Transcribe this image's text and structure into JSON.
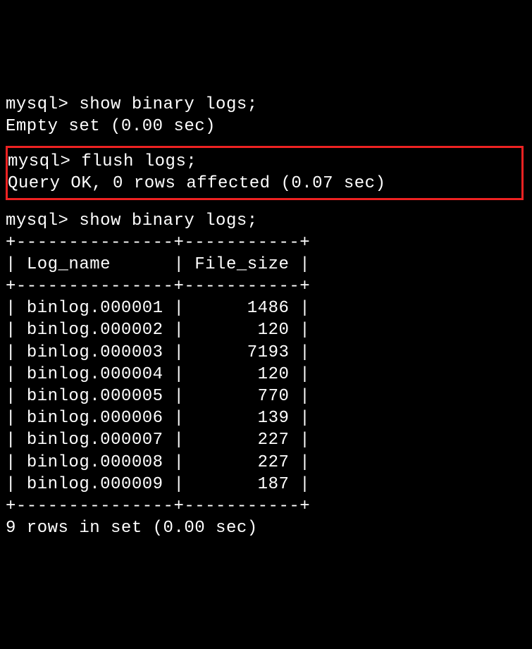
{
  "block1": {
    "prompt": "mysql>",
    "command": "show binary logs;",
    "result": "Empty set (0.00 sec)"
  },
  "block2": {
    "prompt": "mysql>",
    "command": "flush logs;",
    "result": "Query OK, 0 rows affected (0.07 sec)"
  },
  "block3": {
    "prompt": "mysql>",
    "command": "show binary logs;",
    "headers": {
      "col1": "Log_name",
      "col2": "File_size"
    },
    "rows": [
      {
        "log_name": "binlog.000001",
        "file_size": "1486"
      },
      {
        "log_name": "binlog.000002",
        "file_size": "120"
      },
      {
        "log_name": "binlog.000003",
        "file_size": "7193"
      },
      {
        "log_name": "binlog.000004",
        "file_size": "120"
      },
      {
        "log_name": "binlog.000005",
        "file_size": "770"
      },
      {
        "log_name": "binlog.000006",
        "file_size": "139"
      },
      {
        "log_name": "binlog.000007",
        "file_size": "227"
      },
      {
        "log_name": "binlog.000008",
        "file_size": "227"
      },
      {
        "log_name": "binlog.000009",
        "file_size": "187"
      }
    ],
    "footer": "9 rows in set (0.00 sec)"
  },
  "table_border_top": "+---------------+-----------+",
  "table_border_hdr": "+---------------+-----------+",
  "table_border_bot": "+---------------+-----------+"
}
